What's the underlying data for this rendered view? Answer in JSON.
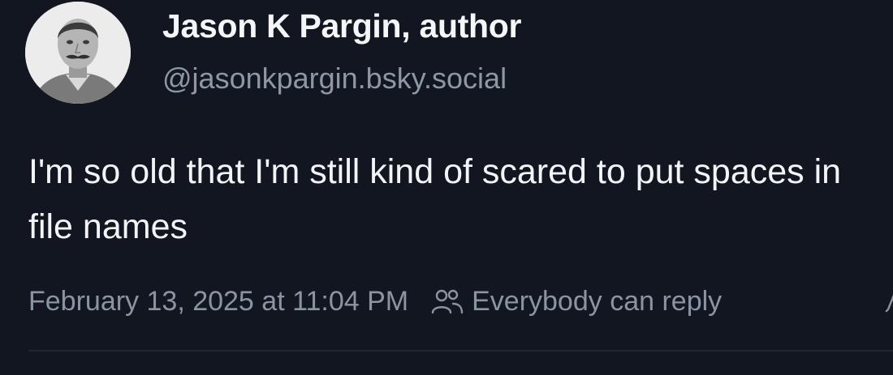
{
  "author": {
    "display_name": "Jason K Pargin, author",
    "handle": "@jasonkpargin.bsky.social",
    "avatar_icon": "avatar-portrait"
  },
  "post": {
    "text": "I'm so old that I'm still kind of scared to put spaces in file names",
    "timestamp": "February 13, 2025 at 11:04 PM",
    "reply_setting": "Everybody can reply",
    "reply_icon": "people-icon"
  },
  "colors": {
    "background": "#121620",
    "primary_text": "#f3f4f6",
    "secondary_text": "#8a94a2"
  }
}
